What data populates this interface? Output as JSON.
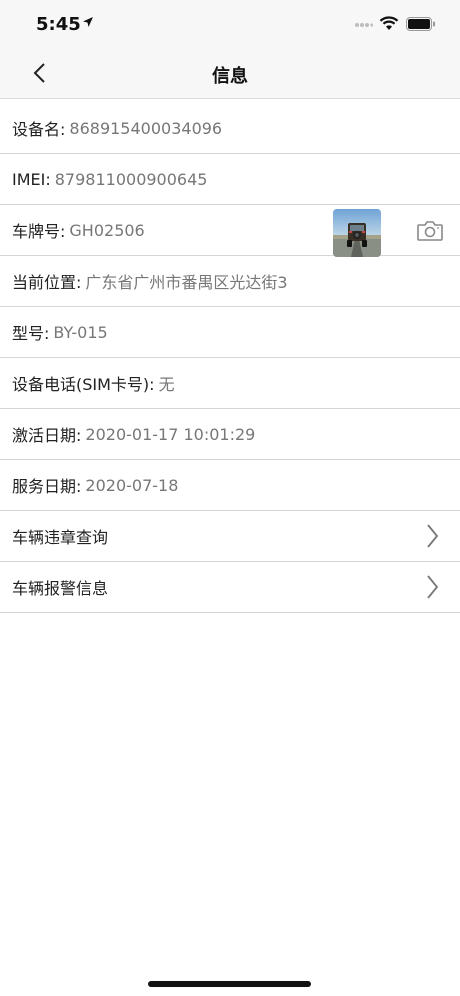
{
  "status_bar": {
    "time": "5:45"
  },
  "nav": {
    "title": "信息"
  },
  "rows": [
    {
      "label": "设备名:",
      "value": "868915400034096"
    },
    {
      "label": "IMEI:",
      "value": "879811000900645"
    },
    {
      "label": "车牌号:",
      "value": "GH02506"
    },
    {
      "label": "当前位置:",
      "value": "广东省广州市番禺区光达街3"
    },
    {
      "label": "型号:",
      "value": "BY-015"
    },
    {
      "label": "设备电话(SIM卡号):",
      "value": "无"
    },
    {
      "label": "激活日期:",
      "value": "2020-01-17 10:01:29"
    },
    {
      "label": "服务日期:",
      "value": "2020-07-18"
    }
  ],
  "links": [
    {
      "label": "车辆违章查询"
    },
    {
      "label": "车辆报警信息"
    }
  ]
}
